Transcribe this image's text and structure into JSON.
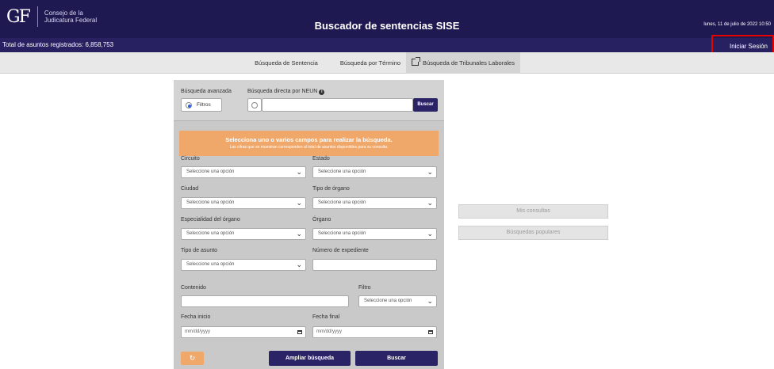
{
  "header": {
    "logo_mark": "GF",
    "logo_line1": "Consejo de la",
    "logo_line2": "Judicatura Federal",
    "title": "Buscador de sentencias SISE",
    "date": "lunes, 11 de julio de 2022 10:50"
  },
  "subbar": {
    "total": "Total de asuntos registrados: 6,858,753",
    "login": "Iniciar Sesión"
  },
  "tabs": [
    {
      "label": "Búsqueda de Sentencia"
    },
    {
      "label": "Búsqueda por Término"
    },
    {
      "label": "Búsqueda de Tribunales Laborales"
    }
  ],
  "search": {
    "advanced_label": "Búsqueda avanzada",
    "direct_label": "Búsqueda directa por NEUN",
    "filters_label": "Filtros",
    "neun_value": "",
    "search_button": "Buscar"
  },
  "notice": {
    "title": "Selecciona uno o varios campos para realizar la búsqueda.",
    "subtitle": "Las cifras que se muestran corresponden al total de asuntos disponibles para su consulta."
  },
  "fields": {
    "circuito": {
      "label": "Circuito",
      "value": "Seleccione una opción"
    },
    "estado": {
      "label": "Estado",
      "value": "Seleccione una opción"
    },
    "ciudad": {
      "label": "Ciudad",
      "value": "Seleccione una opción"
    },
    "tipo_organo": {
      "label": "Tipo de órgano",
      "value": "Seleccione una opción"
    },
    "especialidad": {
      "label": "Especialidad del órgano",
      "value": "Seleccione una opción"
    },
    "organo": {
      "label": "Órgano",
      "value": "Seleccione una opción"
    },
    "tipo_asunto": {
      "label": "Tipo de asunto",
      "value": "Seleccione una opción"
    },
    "expediente": {
      "label": "Número de expediente",
      "value": ""
    },
    "contenido": {
      "label": "Contenido",
      "value": ""
    },
    "filtro": {
      "label": "Filtro",
      "value": "Seleccione una opción"
    },
    "fecha_inicio": {
      "label": "Fecha inicio",
      "placeholder": "mm/dd/yyyy"
    },
    "fecha_final": {
      "label": "Fecha final",
      "placeholder": "mm/dd/yyyy"
    }
  },
  "actions": {
    "reset_symbol": "↻",
    "expand": "Ampliar búsqueda",
    "search": "Buscar"
  },
  "side": {
    "my_queries": "Mis consultas",
    "popular": "Búsquedas populares"
  },
  "colors": {
    "header_bg": "#1e1950",
    "accent_dark": "#2a2466",
    "accent_orange": "#f0a86a",
    "highlight_red": "#e60000"
  }
}
